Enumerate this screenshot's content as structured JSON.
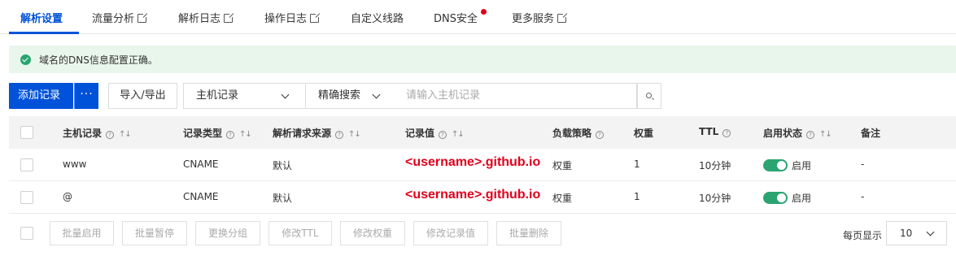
{
  "tabs": [
    {
      "label": "解析设置",
      "active": true,
      "external": false
    },
    {
      "label": "流量分析",
      "active": false,
      "external": true
    },
    {
      "label": "解析日志",
      "active": false,
      "external": true
    },
    {
      "label": "操作日志",
      "active": false,
      "external": true
    },
    {
      "label": "自定义线路",
      "active": false,
      "external": false
    },
    {
      "label": "DNS安全",
      "active": false,
      "external": false,
      "badge_dot": true
    },
    {
      "label": "更多服务",
      "active": false,
      "external": true
    }
  ],
  "banner": {
    "message": "域名的DNS信息配置正确。",
    "icon": "check-circle-icon",
    "color": "#2ba471"
  },
  "toolbar": {
    "add_label": "添加记录",
    "more_label": "···",
    "import_export_label": "导入/导出",
    "field_select": "主机记录",
    "match_select": "精确搜索",
    "search_placeholder": "请输入主机记录"
  },
  "table": {
    "headers": [
      "主机记录",
      "记录类型",
      "解析请求来源",
      "记录值",
      "负载策略",
      "权重",
      "TTL",
      "启用状态",
      "备注"
    ],
    "rows": [
      {
        "host": "www",
        "type": "CNAME",
        "source": "默认",
        "value": "<username>.github.io",
        "strategy": "权重",
        "weight": "1",
        "ttl": "10分钟",
        "enabled": true,
        "status_label": "启用",
        "note": "-"
      },
      {
        "host": "@",
        "type": "CNAME",
        "source": "默认",
        "value": "<username>.github.io",
        "strategy": "权重",
        "weight": "1",
        "ttl": "10分钟",
        "enabled": true,
        "status_label": "启用",
        "note": "-"
      }
    ]
  },
  "footer": {
    "actions": [
      "批量启用",
      "批量暂停",
      "更换分组",
      "修改TTL",
      "修改权重",
      "修改记录值",
      "批量删除"
    ],
    "page_size_label": "每页显示",
    "page_size": "10"
  },
  "colors": {
    "brand": "#0052d9",
    "success": "#2ba471",
    "highlight": "#e0001b"
  }
}
